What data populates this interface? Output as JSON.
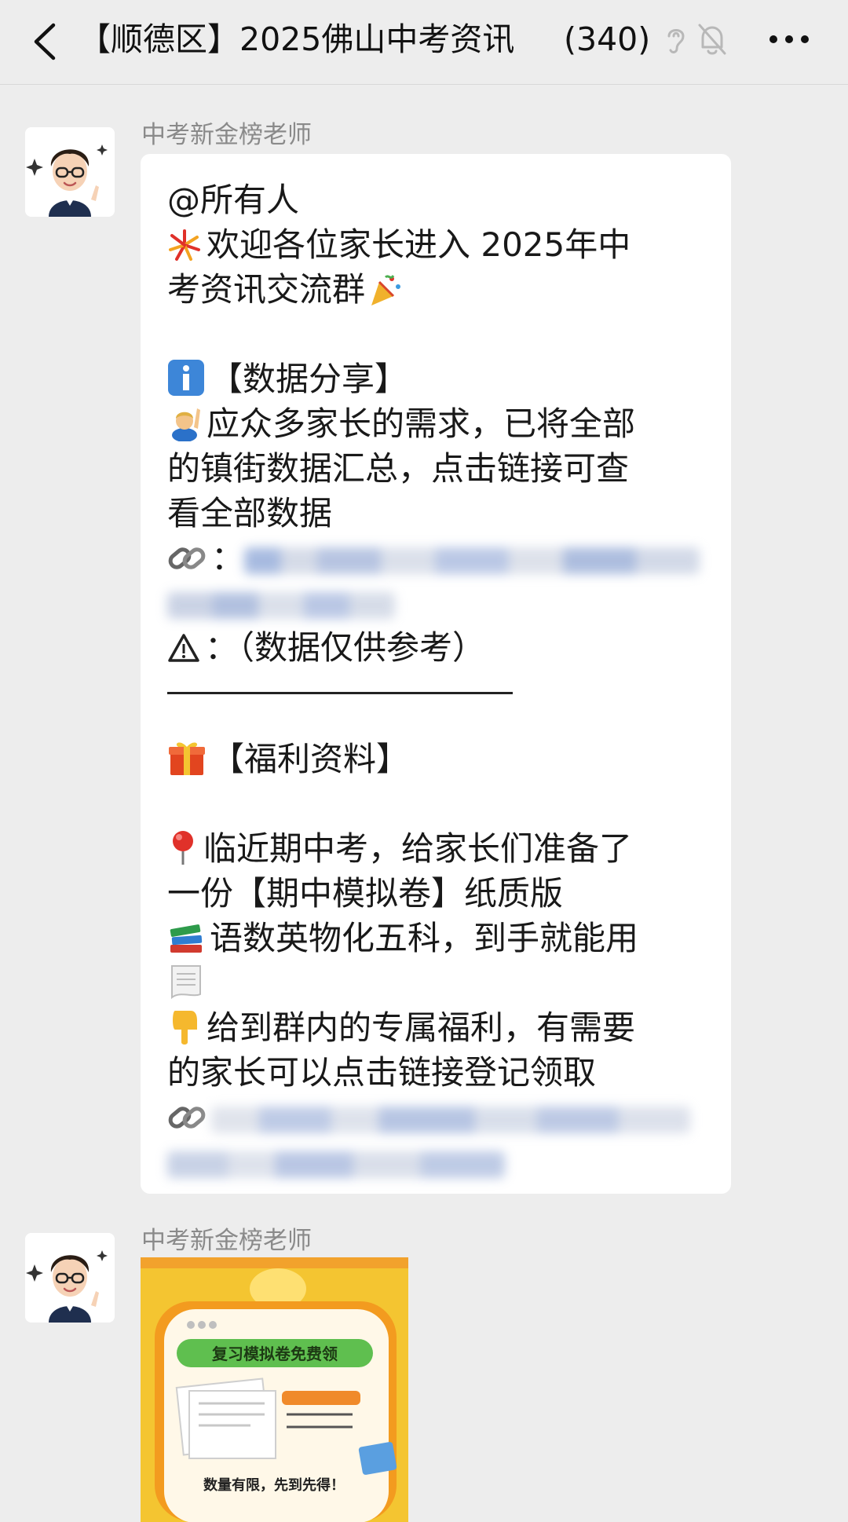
{
  "header": {
    "title_prefix": "【顺德区】2025佛山中考资讯",
    "title_count": "(340)"
  },
  "messages": [
    {
      "sender": "中考新金榜老师",
      "lines": {
        "l1": "@所有人",
        "l2": "欢迎各位家长进入 2025年中",
        "l3": "考资讯交流群",
        "l4": "【数据分享】",
        "l5": "应众多家长的需求，已将全部",
        "l6": "的镇街数据汇总，点击链接可查",
        "l7": "看全部数据",
        "l8": "：",
        "l9": "：（数据仅供参考）",
        "l10": "【福利资料】",
        "l11": "临近期中考，给家长们准备了",
        "l12": "一份【期中模拟卷】纸质版",
        "l13": "语数英物化五科，到手就能用",
        "l14": "给到群内的专属福利，有需要",
        "l15": "的家长可以点击链接登记领取"
      }
    },
    {
      "sender": "中考新金榜老师",
      "image": {
        "banner_text": "复习模拟卷免费领",
        "footer_text": "数量有限，先到先得！"
      }
    }
  ],
  "colors": {
    "background": "#ededed",
    "bubble": "#ffffff",
    "sender_name": "#8a8a8a",
    "card_yellow": "#f4c531",
    "card_banner_green": "#5fbf4f"
  },
  "icons": [
    "chevron-left-icon",
    "ear-icon",
    "bell-muted-icon",
    "more-icon",
    "fireworks-icon",
    "party-popper-icon",
    "info-icon",
    "person-raising-hand-icon",
    "link-icon",
    "warning-icon",
    "gift-icon",
    "pushpin-icon",
    "books-icon",
    "page-icon",
    "pointing-down-icon"
  ]
}
